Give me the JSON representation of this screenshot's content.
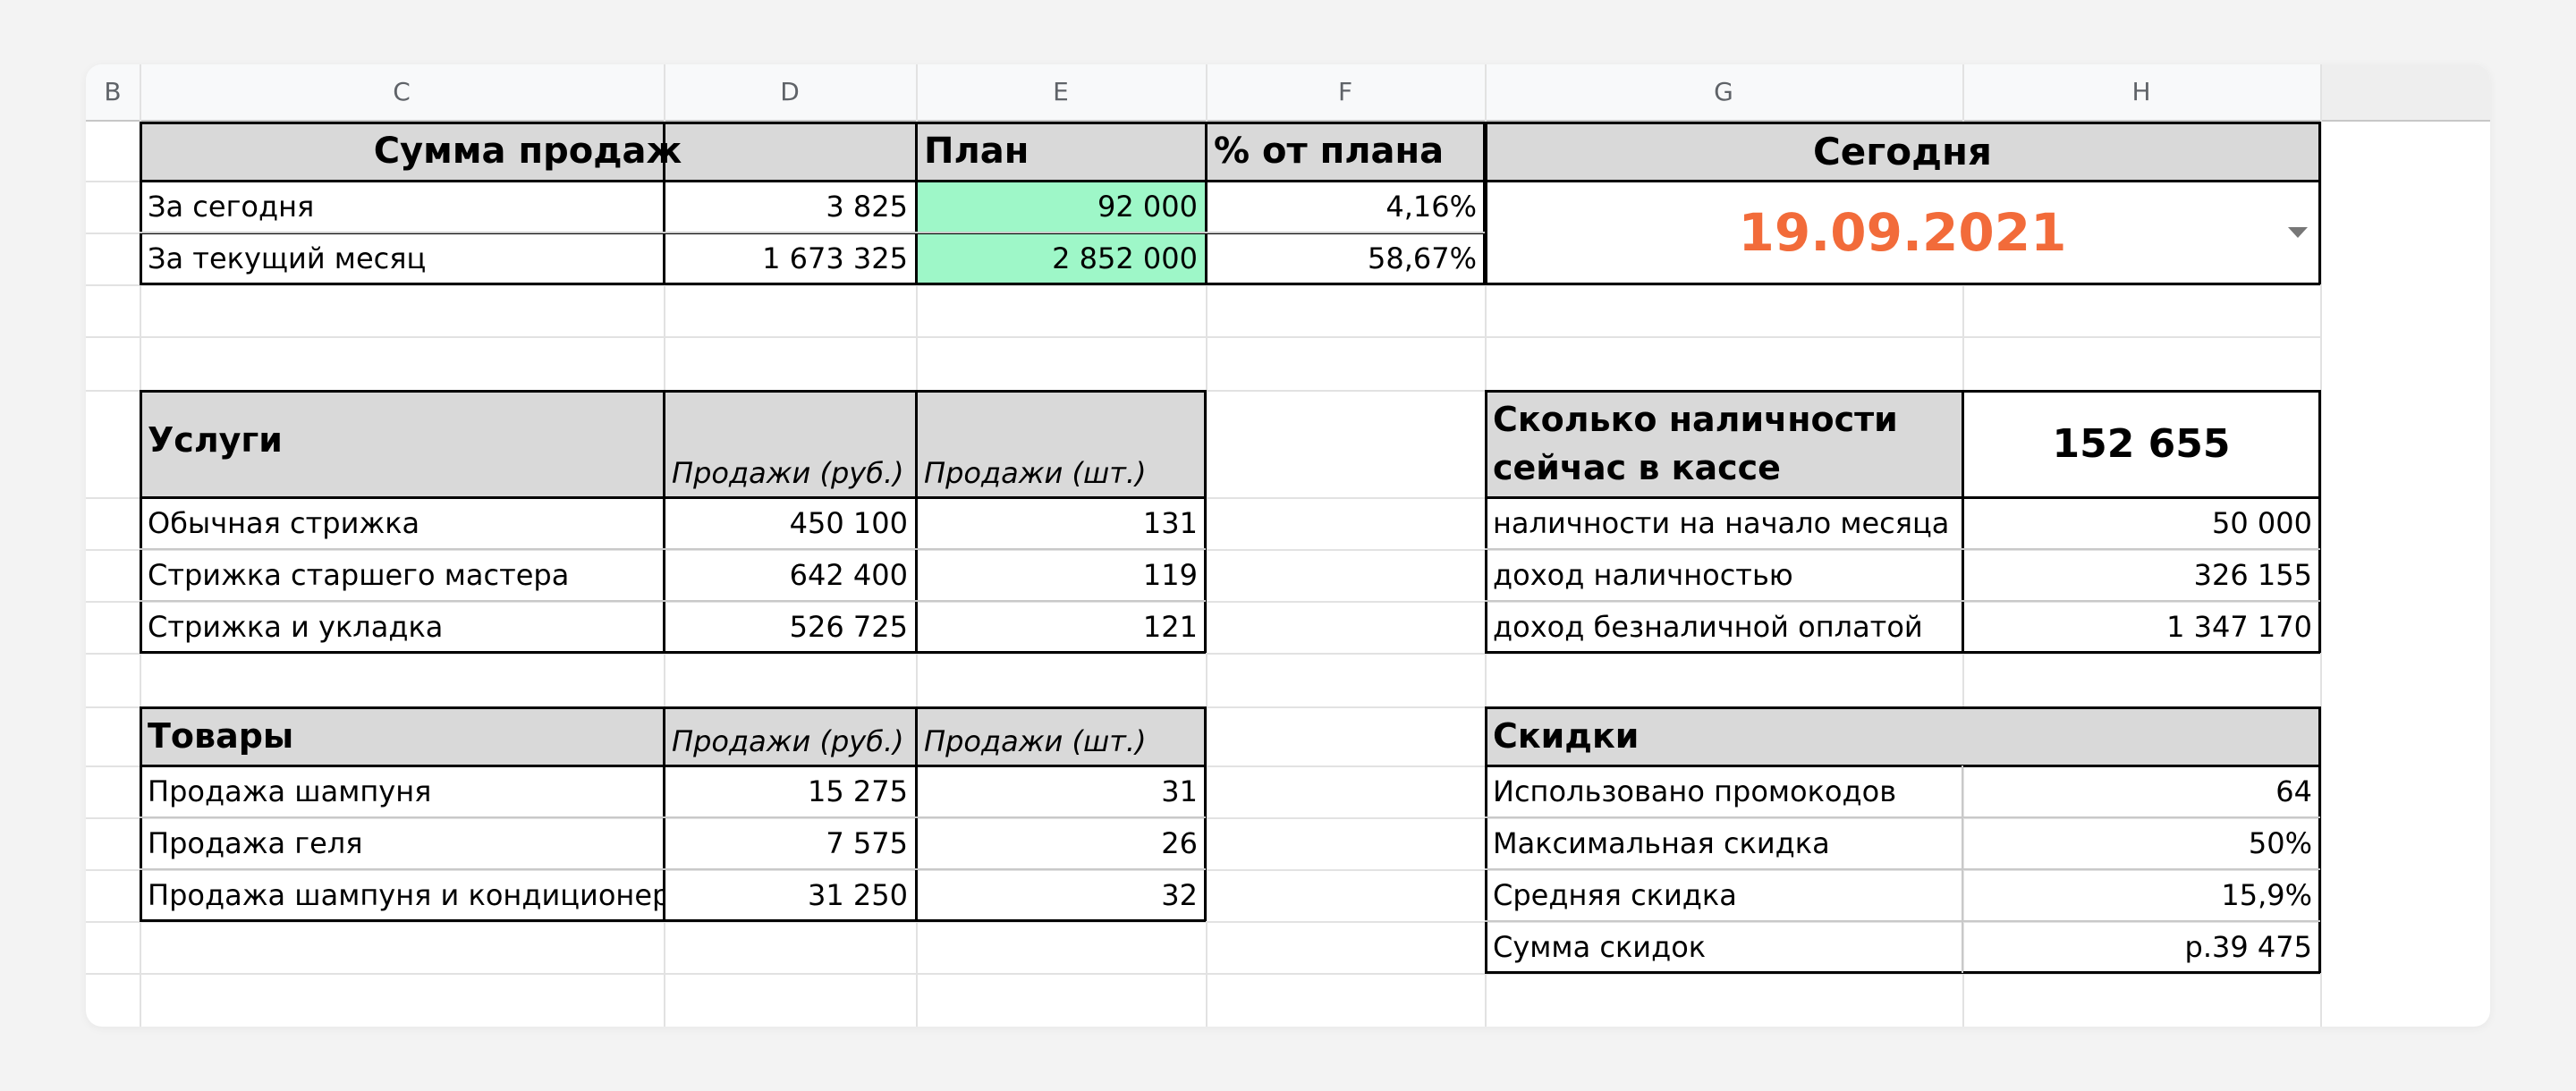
{
  "columns": [
    "B",
    "C",
    "D",
    "E",
    "F",
    "G",
    "H"
  ],
  "sales": {
    "title": "Сумма продаж",
    "plan_header": "План",
    "pct_header": "% от плана",
    "rows": [
      {
        "label": "За сегодня",
        "amount": "3 825",
        "plan": "92 000",
        "pct": "4,16%"
      },
      {
        "label": "За текущий месяц",
        "amount": "1 673 325",
        "plan": "2 852 000",
        "pct": "58,67%"
      }
    ]
  },
  "today": {
    "title": "Сегодня",
    "date": "19.09.2021"
  },
  "services": {
    "title": "Услуги",
    "col_rub": "Продажи (руб.)",
    "col_pcs": "Продажи (шт.)",
    "rows": [
      {
        "name": "Обычная стрижка",
        "rub": "450 100",
        "pcs": "131"
      },
      {
        "name": "Стрижка старшего мастера",
        "rub": "642 400",
        "pcs": "119"
      },
      {
        "name": "Стрижка и укладка",
        "rub": "526 725",
        "pcs": "121"
      }
    ]
  },
  "goods": {
    "title": "Товары",
    "col_rub": "Продажи (руб.)",
    "col_pcs": "Продажи (шт.)",
    "rows": [
      {
        "name": "Продажа шампуня",
        "rub": "15 275",
        "pcs": "31"
      },
      {
        "name": "Продажа геля",
        "rub": "7 575",
        "pcs": "26"
      },
      {
        "name": "Продажа шампуня и кондиционера",
        "rub": "31 250",
        "pcs": "32"
      }
    ]
  },
  "cash": {
    "title_line1": "Сколько наличности",
    "title_line2": "сейчас в кассе",
    "total": "152 655",
    "rows": [
      {
        "label": "наличности на начало месяца",
        "value": "50 000"
      },
      {
        "label": "доход наличностью",
        "value": "326 155"
      },
      {
        "label": "доход безналичной оплатой",
        "value": "1 347 170"
      }
    ]
  },
  "discounts": {
    "title": "Скидки",
    "rows": [
      {
        "label": "Использовано  промокодов",
        "value": "64"
      },
      {
        "label": "Максимальная скидка",
        "value": "50%"
      },
      {
        "label": "Средняя скидка",
        "value": "15,9%"
      },
      {
        "label": "Сумма скидок",
        "value": "р.39 475"
      }
    ]
  },
  "colors": {
    "accent": "#f26b3a",
    "plan_fill": "#9ef7c8",
    "header_fill": "#d9d9d9"
  }
}
